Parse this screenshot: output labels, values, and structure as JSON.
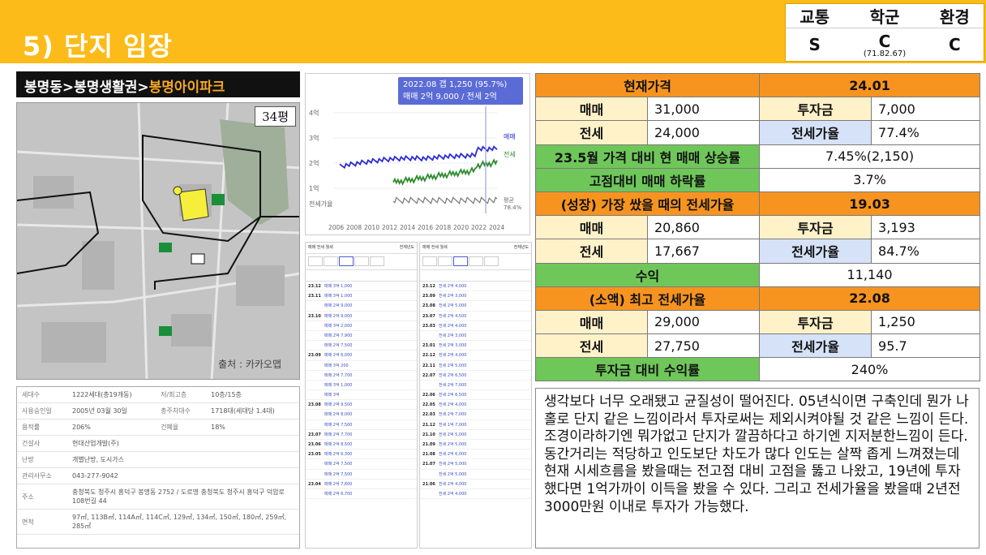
{
  "header": {
    "title": "5) 단지 임장"
  },
  "grades": {
    "labels": [
      "교통",
      "학군",
      "환경"
    ],
    "values": [
      "S",
      "C",
      "C"
    ],
    "school_sub": "(71.82.67)"
  },
  "breadcrumb": {
    "path": "봉명동>봉명생활권>",
    "complex": "봉명아이파크"
  },
  "map": {
    "size_badge": "34평",
    "attribution": "출처 : 카카오맵"
  },
  "info": {
    "rows": [
      {
        "k1": "세대수",
        "v1": "1222세대(총19개동)",
        "k2": "저/최고층",
        "v2": "10층/15층"
      },
      {
        "k1": "사용승인일",
        "v1": "2005년 03월 30일",
        "k2": "총주차대수",
        "v2": "1718대(세대당 1.4대)"
      },
      {
        "k1": "용적률",
        "v1": "206%",
        "k2": "건폐율",
        "v2": "18%"
      },
      {
        "k1": "건설사",
        "v1": "현대산업개발(주)",
        "k2": "",
        "v2": ""
      },
      {
        "k1": "난방",
        "v1": "개별난방, 도시가스",
        "k2": "",
        "v2": ""
      },
      {
        "k1": "관리사무소",
        "v1": "043-277-9042",
        "k2": "",
        "v2": ""
      },
      {
        "k1": "주소",
        "v1": "충청북도 청주시 흥덕구 봉명동 2752 / 도로명 충청북도 청주시 흥덕구 덕암로108번길 44",
        "k2": "",
        "v2": ""
      },
      {
        "k1": "면적",
        "v1": "97㎡, 113B㎡, 114A㎡, 114C㎡, 129㎡, 134㎡, 150㎡, 180㎡, 259㎡, 285㎡",
        "k2": "",
        "v2": ""
      }
    ]
  },
  "price_chart": {
    "tooltip_line1": "2022.08  갭 1,250 (95.7%)",
    "tooltip_line2": "매매 2억 9,000 / 전세 2억 7,750",
    "y_labels": [
      "4억",
      "3억",
      "2억",
      "1억",
      "전세가율"
    ],
    "x_labels": [
      "2006",
      "2008",
      "2010",
      "2012",
      "2014",
      "2016",
      "2018",
      "2020",
      "2022",
      "2024"
    ],
    "series_labels": [
      "매매",
      "전세",
      "평균 78.4%"
    ],
    "colors": {
      "sale": "#2b2bd6",
      "jeonse": "#2e8b2e",
      "ratio": "#777777",
      "marker": "#9aa4e6"
    }
  },
  "tx_lists": [
    {
      "tabs": "매매  전세  월세",
      "region": "전체년도",
      "rows": [
        [
          "23.12",
          "매매 3억 1,000"
        ],
        [
          "23.11",
          "매매 3억 1,000"
        ],
        [
          "",
          "매매 2억 9,000"
        ],
        [
          "23.10",
          "매매 2억 9,000"
        ],
        [
          "",
          "매매 3억 2,000"
        ],
        [
          "",
          "매매 2억 7,900"
        ],
        [
          "",
          "매매 2억 7,500"
        ],
        [
          "23.09",
          "매매 2억 6,000"
        ],
        [
          "",
          "매매 3억 200"
        ],
        [
          "",
          "매매 2억 7,700"
        ],
        [
          "",
          "매매 3억 1,000"
        ],
        [
          "",
          "매매 3억"
        ],
        [
          "23.08",
          "매매 2억 9,500"
        ],
        [
          "",
          "매매 2억 8,000"
        ],
        [
          "",
          "매매 2억 7,500"
        ],
        [
          "23.07",
          "매매 2억 7,700"
        ],
        [
          "23.06",
          "매매 2억 8,500"
        ],
        [
          "23.05",
          "매매 2억 6,300"
        ],
        [
          "",
          "매매 2억 7,500"
        ],
        [
          "",
          "매매 2억 7,500"
        ],
        [
          "23.04",
          "매매 2억 7,600"
        ],
        [
          "",
          "매매 2억 6,700"
        ]
      ]
    },
    {
      "tabs": "매매  전세  월세",
      "region": "전체년도",
      "rows": [
        [
          "23.12",
          "전세 2억 4,000"
        ],
        [
          "23.09",
          "전세 2억 3,000"
        ],
        [
          "23.08",
          "전세 2억 5,000"
        ],
        [
          "23.07",
          "전세 2억 4,500"
        ],
        [
          "23.03",
          "전세 2억 4,000"
        ],
        [
          "",
          "전세 2억 3,000"
        ],
        [
          "23.01",
          "전세 2억 3,000"
        ],
        [
          "22.12",
          "전세 2억 4,000"
        ],
        [
          "22.11",
          "전세 2억 5,000"
        ],
        [
          "22.07",
          "전세 2억 6,500"
        ],
        [
          "",
          "전세 2억 7,000"
        ],
        [
          "22.06",
          "전세 2억 6,500"
        ],
        [
          "22.05",
          "전세 2억 4,000"
        ],
        [
          "22.03",
          "전세 2억 7,000"
        ],
        [
          "21.12",
          "전세 1억 7,000"
        ],
        [
          "21.10",
          "전세 2억 5,000"
        ],
        [
          "21.09",
          "전세 2억 5,000"
        ],
        [
          "21.08",
          "전세 2억 6,000"
        ],
        [
          "21.07",
          "전세 2억 5,000"
        ],
        [
          "",
          "전세 2억 5,000"
        ],
        [
          "21.06",
          "전세 2억 4,000"
        ],
        [
          "",
          "전세 2억 4,000"
        ]
      ]
    }
  ],
  "table": {
    "current_label": "현재가격",
    "current_date": "24.01",
    "sale_label": "매매",
    "jeonse_label": "전세",
    "invest_label": "투자금",
    "ratio_label": "전세가율",
    "current": {
      "sale": "31,000",
      "invest": "7,000",
      "jeonse": "24,000",
      "ratio": "77.4%"
    },
    "rise_label": "23.5월 가격 대비 현 매매 상승률",
    "rise_value": "7.45%(2,150)",
    "drop_label": "고점대비 매매 하락률",
    "drop_value": "3.7%",
    "growth_label": "(성장) 가장 쌌을 때의 전세가율",
    "growth_date": "19.03",
    "growth": {
      "sale": "20,860",
      "invest": "3,193",
      "jeonse": "17,667",
      "ratio": "84.7%"
    },
    "profit_label": "수익",
    "profit_value": "11,140",
    "peak_label": "(소액) 최고 전세가율",
    "peak_date": "22.08",
    "peak": {
      "sale": "29,000",
      "invest": "1,250",
      "jeonse": "27,750",
      "ratio": "95.7"
    },
    "roi_label": "투자금 대비 수익률",
    "roi_value": "240%"
  },
  "comment": "생각보다 너무 오래됐고 균질성이 떨어진다. 05년식이면 구축인데 뭔가 나홀로 단지 같은 느낌이라서 투자로써는 제외시켜야될 것 같은 느낌이 든다. 조경이라하기엔 뭐가없고 단지가 깔끔하다고 하기엔 지저분한느낌이 든다. 동간거리는 적당하고 인도보단 차도가 많다 인도는 살짝 좁게 느껴졌는데 현재 시세흐름을 봤을때는 전고점 대비 고점을 뚫고 나왔고, 19년에 투자했다면 1억가까이 이득을 봤을 수 있다. 그리고 전세가율을 봤을때 2년전 3000만원 이내로 투자가 가능했다."
}
